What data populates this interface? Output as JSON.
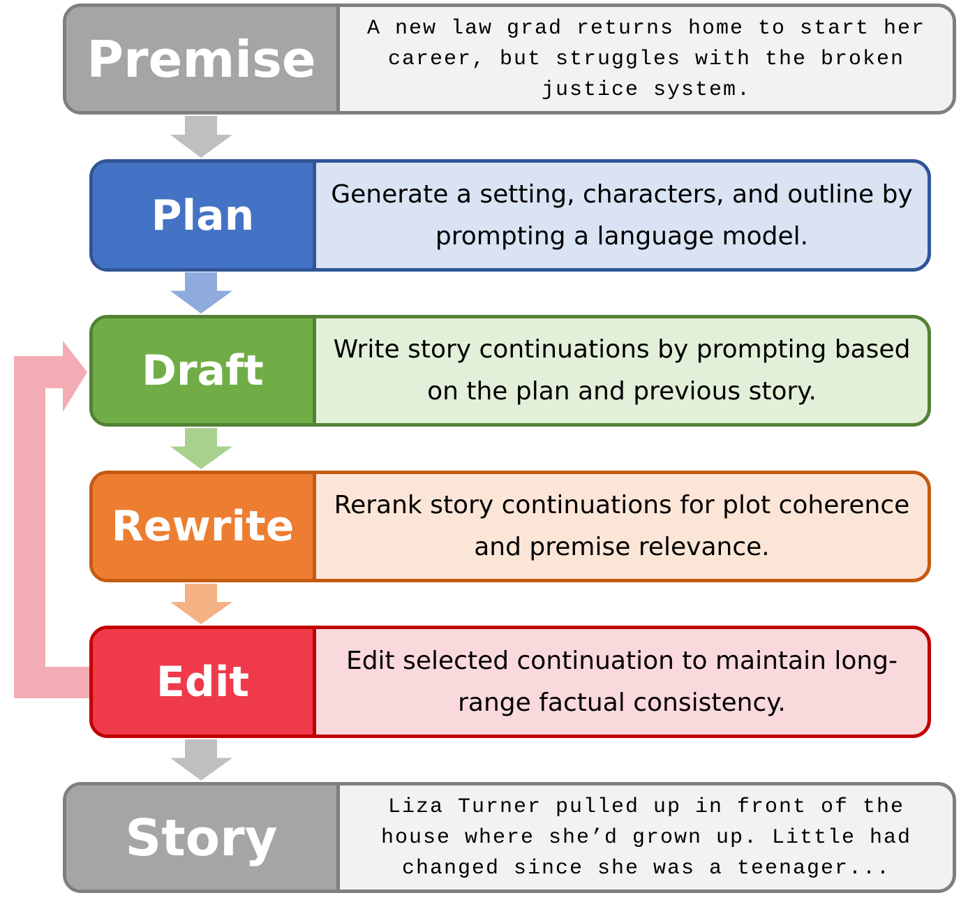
{
  "stages": [
    {
      "label": "Premise",
      "text": "A new law grad returns home to start her career, but struggles with the broken justice system.",
      "fill": "#a5a5a5",
      "border": "#7f7f7f",
      "bg": "#f2f2f2",
      "mono": true
    },
    {
      "label": "Plan",
      "text": "Generate a setting, characters, and outline by prompting a language model.",
      "fill": "#4472c4",
      "border": "#2f5597",
      "bg": "#dae3f3"
    },
    {
      "label": "Draft",
      "text": "Write story continuations by prompting based on the plan and previous story.",
      "fill": "#70ad47",
      "border": "#538135",
      "bg": "#e2f0d9"
    },
    {
      "label": "Rewrite",
      "text": "Rerank story continuations for plot coherence and premise relevance.",
      "fill": "#ed7d31",
      "border": "#c55a11",
      "bg": "#fbe5d6"
    },
    {
      "label": "Edit",
      "text": "Edit selected continuation to maintain long-range factual consistency.",
      "fill": "#ee3a4a",
      "border": "#c00000",
      "bg": "#fad9dd"
    },
    {
      "label": "Story",
      "text": "Liza Turner pulled up in front of the house where she’d grown up. Little had changed since she was a teenager...",
      "fill": "#a5a5a5",
      "border": "#7f7f7f",
      "bg": "#f2f2f2",
      "mono": true
    }
  ],
  "arrows": {
    "colors": [
      "#bfbfbf",
      "#8faadc",
      "#a9d18e",
      "#f4b183",
      "#bfbfbf"
    ],
    "feedback": "#f4acb4"
  }
}
